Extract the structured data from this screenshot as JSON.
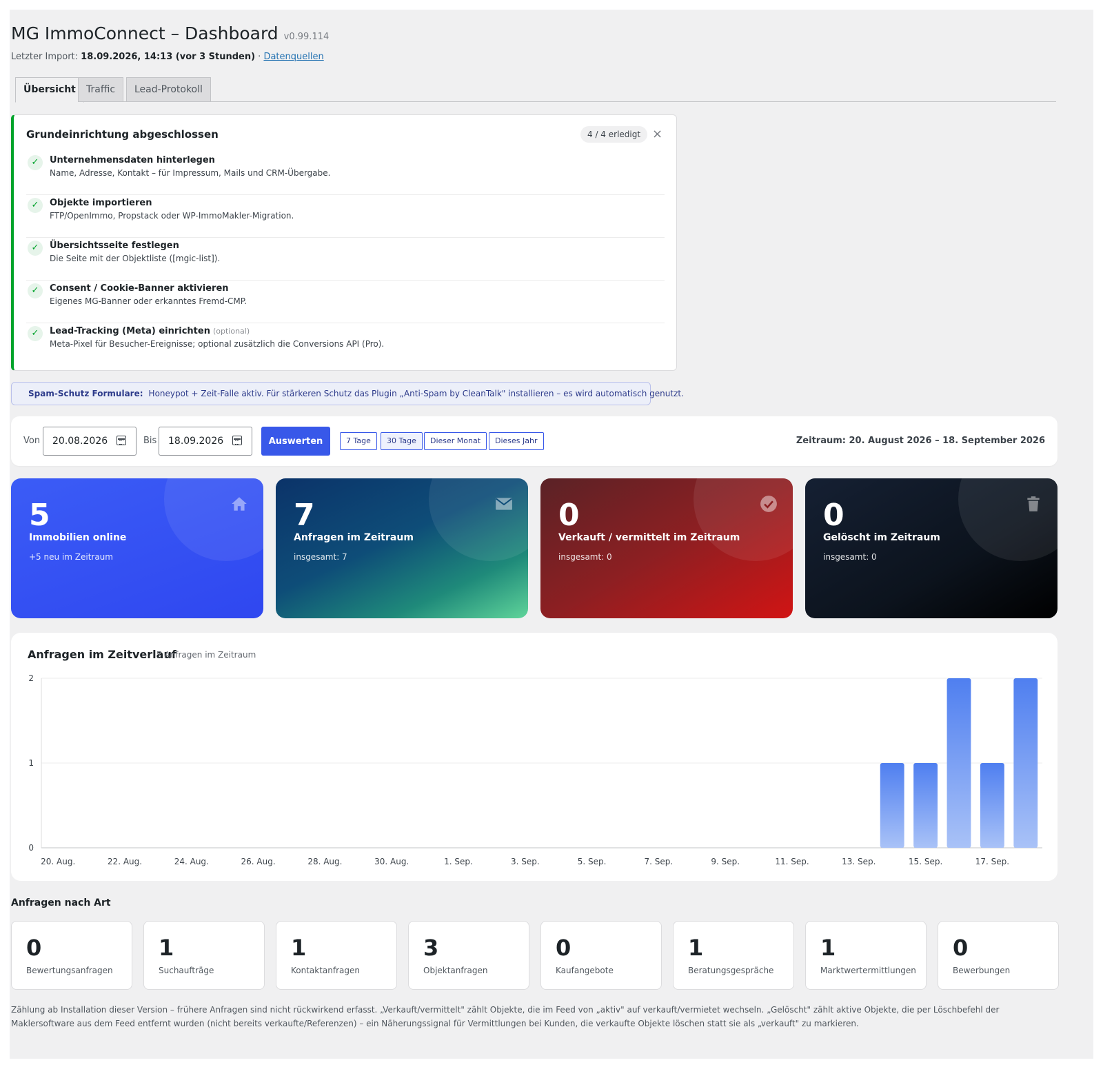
{
  "header": {
    "title": "MG ImmoConnect – Dashboard",
    "version": "v0.99.114",
    "import_label": "Letzter Import:",
    "import_value": "18.09.2026, 14:13 (vor 3 Stunden)",
    "separator": " · ",
    "sources_link": "Datenquellen"
  },
  "tabs": [
    {
      "label": "Übersicht",
      "active": true
    },
    {
      "label": "Traffic",
      "active": false
    },
    {
      "label": "Lead-Protokoll",
      "active": false
    }
  ],
  "setup": {
    "title": "Grundeinrichtung abgeschlossen",
    "badge": "4 / 4 erledigt",
    "close": "×",
    "steps": [
      {
        "title": "Unternehmensdaten hinterlegen",
        "desc": "Name, Adresse, Kontakt – für Impressum, Mails und CRM-Übergabe.",
        "optional": ""
      },
      {
        "title": "Objekte importieren",
        "desc": "FTP/OpenImmo, Propstack oder WP-ImmoMakler-Migration.",
        "optional": ""
      },
      {
        "title": "Übersichtsseite festlegen",
        "desc": "Die Seite mit der Objektliste ([mgic-list]).",
        "optional": ""
      },
      {
        "title": "Consent / Cookie-Banner aktivieren",
        "desc": "Eigenes MG-Banner oder erkanntes Fremd-CMP.",
        "optional": ""
      },
      {
        "title": "Lead-Tracking (Meta) einrichten",
        "desc": "Meta-Pixel für Besucher-Ereignisse; optional zusätzlich die Conversions API (Pro).",
        "optional": "(optional)"
      }
    ]
  },
  "spam": {
    "label": "Spam-Schutz Formulare:",
    "text": "Honeypot + Zeit-Falle aktiv. Für stärkeren Schutz das Plugin „Anti-Spam by CleanTalk\" installieren – es wird automatisch genutzt."
  },
  "filter": {
    "from_label": "Von",
    "from_value": "20.08.2026",
    "to_label": "Bis",
    "to_value": "18.09.2026",
    "submit": "Auswerten",
    "quick": [
      {
        "label": "7 Tage",
        "active": false
      },
      {
        "label": "30 Tage",
        "active": true
      },
      {
        "label": "Dieser Monat",
        "active": false
      },
      {
        "label": "Dieses Jahr",
        "active": false
      }
    ],
    "range_text": "Zeitraum: 20. August 2026 – 18. September 2026"
  },
  "kpis": [
    {
      "value": "5",
      "label": "Immobilien online",
      "sub": "+5 neu im Zeitraum",
      "icon": "home-icon"
    },
    {
      "value": "7",
      "label": "Anfragen im Zeitraum",
      "sub": "insgesamt: 7",
      "icon": "mail-icon"
    },
    {
      "value": "0",
      "label": "Verkauft / vermittelt im Zeitraum",
      "sub": "insgesamt: 0",
      "icon": "check-circle-icon"
    },
    {
      "value": "0",
      "label": "Gelöscht im Zeitraum",
      "sub": "insgesamt: 0",
      "icon": "trash-icon"
    }
  ],
  "chart": {
    "title": "Anfragen im Zeitverlauf",
    "subtitle": "7 Anfragen im Zeitraum"
  },
  "chart_data": {
    "type": "bar",
    "title": "Anfragen im Zeitverlauf",
    "xlabel": "",
    "ylabel": "",
    "ylim": [
      0,
      2
    ],
    "yticks": [
      "0",
      "1",
      "2"
    ],
    "grid": true,
    "categories": [
      "20. Aug.",
      "21. Aug.",
      "22. Aug.",
      "23. Aug.",
      "24. Aug.",
      "25. Aug.",
      "26. Aug.",
      "27. Aug.",
      "28. Aug.",
      "29. Aug.",
      "30. Aug.",
      "31. Aug.",
      "1. Sep.",
      "2. Sep.",
      "3. Sep.",
      "4. Sep.",
      "5. Sep.",
      "6. Sep.",
      "7. Sep.",
      "8. Sep.",
      "9. Sep.",
      "10. Sep.",
      "11. Sep.",
      "12. Sep.",
      "13. Sep.",
      "14. Sep.",
      "15. Sep.",
      "16. Sep.",
      "17. Sep.",
      "18. Sep."
    ],
    "tick_labels": [
      "20. Aug.",
      "22. Aug.",
      "24. Aug.",
      "26. Aug.",
      "28. Aug.",
      "30. Aug.",
      "1. Sep.",
      "3. Sep.",
      "5. Sep.",
      "7. Sep.",
      "9. Sep.",
      "11. Sep.",
      "13. Sep.",
      "15. Sep.",
      "17. Sep."
    ],
    "values": [
      0,
      0,
      0,
      0,
      0,
      0,
      0,
      0,
      0,
      0,
      0,
      0,
      0,
      0,
      0,
      0,
      0,
      0,
      0,
      0,
      0,
      0,
      0,
      0,
      0,
      1,
      1,
      2,
      1,
      2
    ],
    "color": "#4f7ff0"
  },
  "types": {
    "title": "Anfragen nach Art",
    "items": [
      {
        "value": "0",
        "label": "Bewertungsanfragen"
      },
      {
        "value": "1",
        "label": "Suchaufträge"
      },
      {
        "value": "1",
        "label": "Kontaktanfragen"
      },
      {
        "value": "3",
        "label": "Objektanfragen"
      },
      {
        "value": "0",
        "label": "Kaufangebote"
      },
      {
        "value": "1",
        "label": "Beratungsgespräche"
      },
      {
        "value": "1",
        "label": "Marktwertermittlungen"
      },
      {
        "value": "0",
        "label": "Bewerbungen"
      }
    ]
  },
  "footnote": "Zählung ab Installation dieser Version – frühere Anfragen sind nicht rückwirkend erfasst. „Verkauft/vermittelt\" zählt Objekte, die im Feed von „aktiv\" auf verkauft/vermietet wechseln. „Gelöscht\" zählt aktive Objekte, die per Löschbefehl der Maklersoftware aus dem Feed entfernt wurden (nicht bereits verkaufte/Referenzen) – ein Näherungssignal für Vermittlungen bei Kunden, die verkaufte Objekte löschen statt sie als „verkauft\" zu markieren.",
  "colors": {
    "accent": "#3858e9",
    "success": "#00a32a",
    "chart_bar": "#4f7ff0"
  }
}
